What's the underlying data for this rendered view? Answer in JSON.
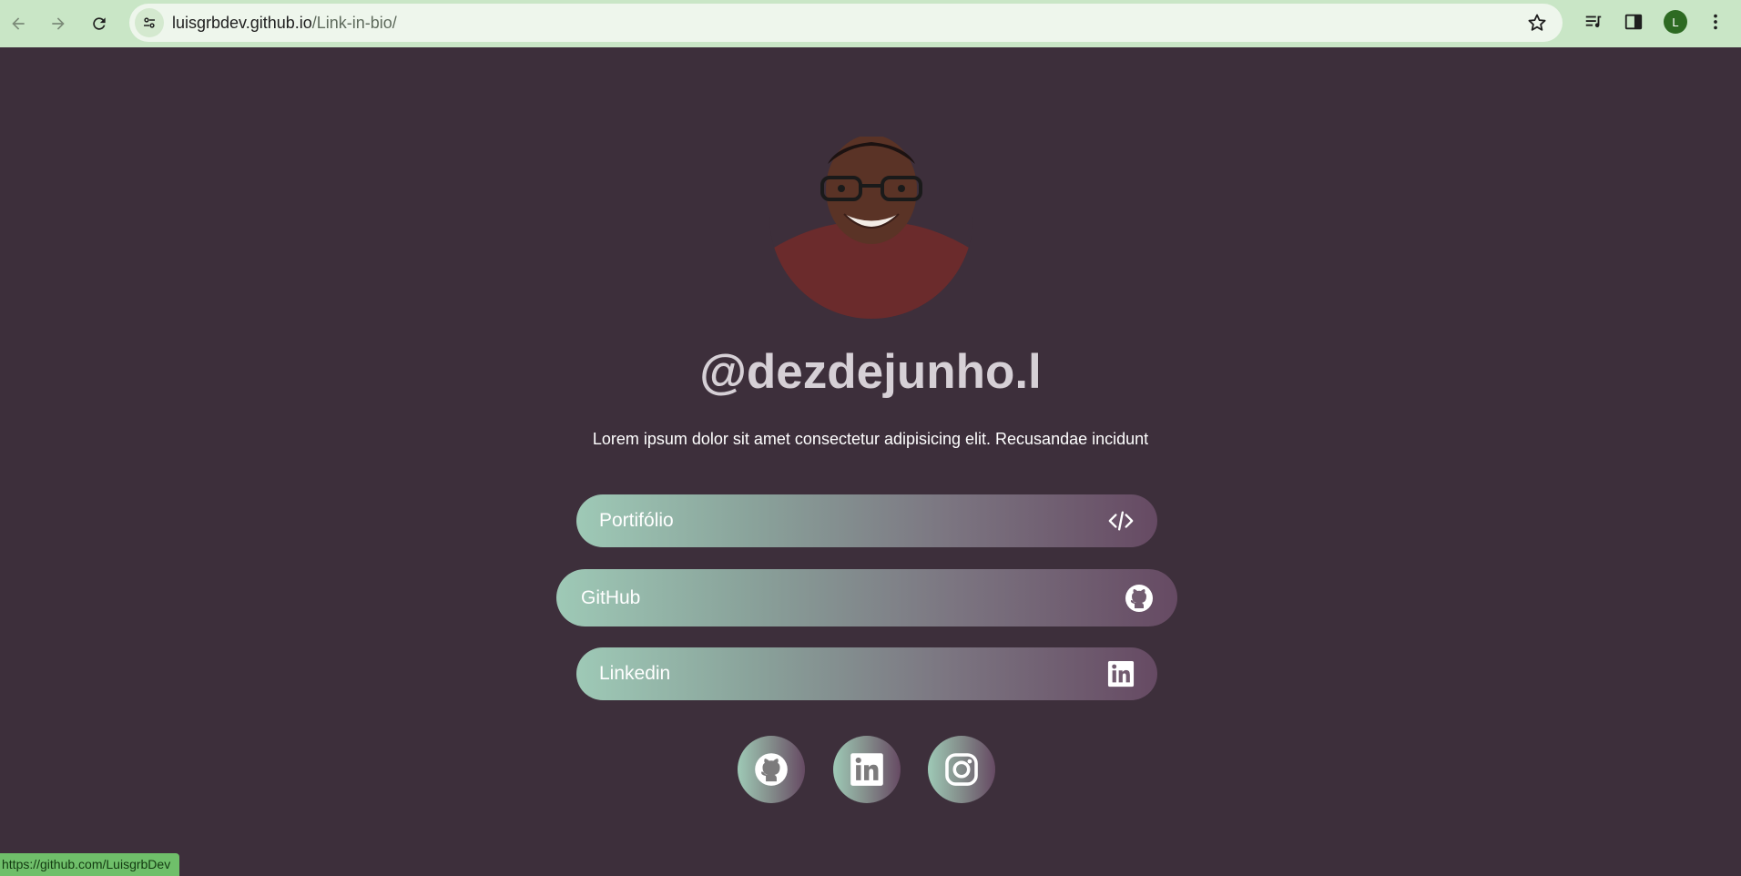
{
  "browser": {
    "url_host": "luisgrbdev.github.io",
    "url_path": "/Link-in-bio/",
    "profile_initial": "L"
  },
  "profile": {
    "username": "@dezdejunho.l",
    "bio": "Lorem ipsum dolor sit amet consectetur adipisicing elit. Recusandae incidunt"
  },
  "links": [
    {
      "label": "Portifólio",
      "icon": "code-icon"
    },
    {
      "label": "GitHub",
      "icon": "github-icon"
    },
    {
      "label": "Linkedin",
      "icon": "linkedin-icon"
    }
  ],
  "social": [
    {
      "icon": "github-icon"
    },
    {
      "icon": "linkedin-icon"
    },
    {
      "icon": "instagram-icon"
    }
  ],
  "status_bar": {
    "text": "https://github.com/LuisgrbDev"
  },
  "colors": {
    "page_background": "#3d2f3b",
    "browser_bar": "#c9e6c6",
    "gradient_start": "#9ec9b6",
    "gradient_end": "#664a63",
    "status_bar": "#6fbf6a"
  }
}
